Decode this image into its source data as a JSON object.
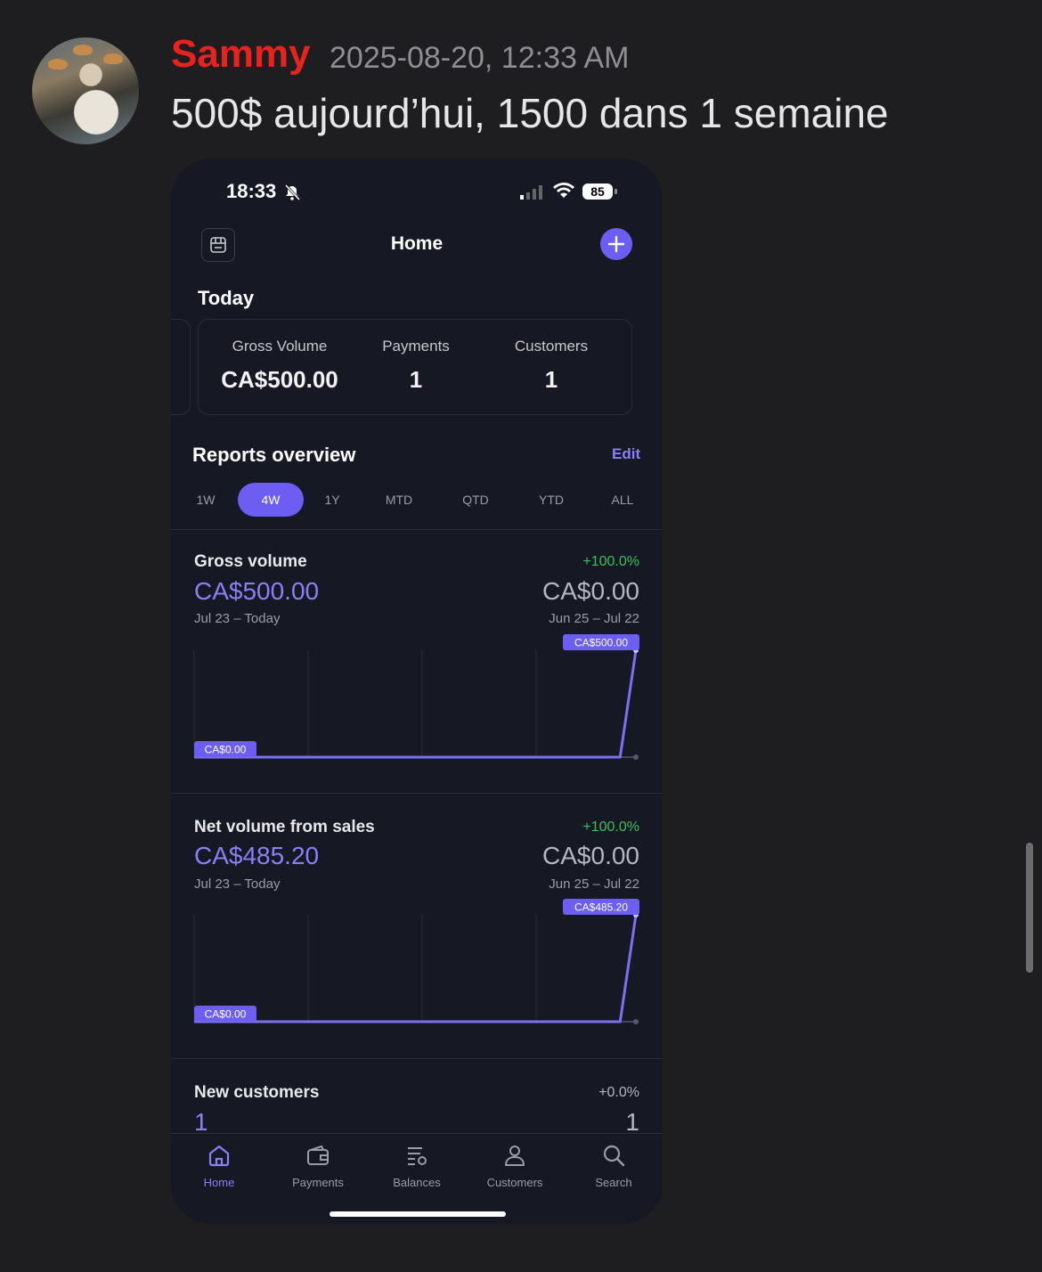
{
  "chat": {
    "username": "Sammy",
    "timestamp": "2025-08-20, 12:33 AM",
    "message": "500$ aujourd’hui, 1500 dans 1 semaine"
  },
  "phone": {
    "status": {
      "time": "18:33",
      "battery": "85"
    },
    "header": {
      "title": "Home"
    },
    "today": {
      "title": "Today",
      "metrics": [
        {
          "label": "Gross Volume",
          "value": "CA$500.00"
        },
        {
          "label": "Payments",
          "value": "1"
        },
        {
          "label": "Customers",
          "value": "1"
        }
      ]
    },
    "reports": {
      "title": "Reports overview",
      "edit_label": "Edit",
      "tabs": [
        "1W",
        "4W",
        "1Y",
        "MTD",
        "QTD",
        "YTD",
        "ALL"
      ],
      "active_tab": "4W"
    },
    "sections": [
      {
        "label": "Gross volume",
        "value": "CA$500.00",
        "range": "Jul 23 – Today",
        "change": "+100.0%",
        "prev_value": "CA$0.00",
        "prev_range": "Jun 25 – Jul 22",
        "chart_start_label": "CA$0.00",
        "chart_end_label": "CA$500.00"
      },
      {
        "label": "Net volume from sales",
        "value": "CA$485.20",
        "range": "Jul 23 – Today",
        "change": "+100.0%",
        "prev_value": "CA$0.00",
        "prev_range": "Jun 25 – Jul 22",
        "chart_start_label": "CA$0.00",
        "chart_end_label": "CA$485.20"
      },
      {
        "label": "New customers",
        "value": "1",
        "change": "+0.0%",
        "prev_value": "1"
      }
    ],
    "tabbar": [
      {
        "label": "Home",
        "icon": "home-icon"
      },
      {
        "label": "Payments",
        "icon": "wallet-icon"
      },
      {
        "label": "Balances",
        "icon": "balances-icon"
      },
      {
        "label": "Customers",
        "icon": "user-icon"
      },
      {
        "label": "Search",
        "icon": "search-icon"
      }
    ],
    "accent_color": "#6c5ef2",
    "positive_color": "#37c05a"
  },
  "chart_data": [
    {
      "type": "line",
      "x": [
        0,
        1,
        2,
        3,
        4,
        5,
        6,
        7,
        8,
        9,
        10,
        11,
        12,
        13,
        14,
        15,
        16,
        17,
        18,
        19,
        20,
        21,
        22,
        23,
        24,
        25,
        26,
        27,
        28
      ],
      "series": [
        {
          "values": [
            0,
            0,
            0,
            0,
            0,
            0,
            0,
            0,
            0,
            0,
            0,
            0,
            0,
            0,
            0,
            0,
            0,
            0,
            0,
            0,
            0,
            0,
            0,
            0,
            0,
            0,
            0,
            0,
            500
          ]
        }
      ],
      "ylim": [
        0,
        500
      ],
      "point_labels": [
        "CA$0.00",
        "CA$500.00"
      ]
    },
    {
      "type": "line",
      "x": [
        0,
        1,
        2,
        3,
        4,
        5,
        6,
        7,
        8,
        9,
        10,
        11,
        12,
        13,
        14,
        15,
        16,
        17,
        18,
        19,
        20,
        21,
        22,
        23,
        24,
        25,
        26,
        27,
        28
      ],
      "series": [
        {
          "values": [
            0,
            0,
            0,
            0,
            0,
            0,
            0,
            0,
            0,
            0,
            0,
            0,
            0,
            0,
            0,
            0,
            0,
            0,
            0,
            0,
            0,
            0,
            0,
            0,
            0,
            0,
            0,
            0,
            485.2
          ]
        }
      ],
      "ylim": [
        0,
        485.2
      ],
      "point_labels": [
        "CA$0.00",
        "CA$485.20"
      ]
    }
  ]
}
